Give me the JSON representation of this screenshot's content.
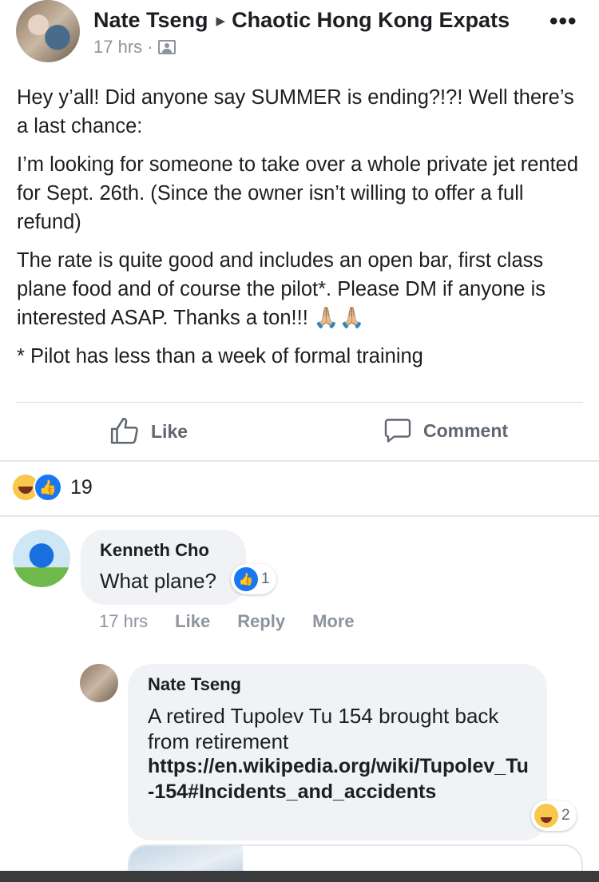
{
  "post": {
    "author": "Nate Tseng",
    "group": "Chaotic Hong Kong Expats",
    "time": "17 hrs ·",
    "paragraphs": [
      "Hey y’all! Did anyone say SUMMER is ending?!?! Well there’s a last chance:",
      "I’m looking for someone to take over a whole private jet rented for Sept. 26th. (Since the owner isn’t willing to offer a full refund)",
      "The rate is quite good and includes an open bar, first class plane food and of course the pilot*. Please DM if anyone is interested ASAP. Thanks a ton!!! 🙏🏼🙏🏼",
      "* Pilot has less than a week of formal training"
    ],
    "more_icon": "•••"
  },
  "actions": {
    "like_label": "Like",
    "comment_label": "Comment"
  },
  "reactions": {
    "count": "19",
    "icons": [
      "haha-icon",
      "like-icon"
    ]
  },
  "comments": [
    {
      "author": "Kenneth Cho",
      "text": "What plane?",
      "reaction_count": "1",
      "time": "17 hrs",
      "like": "Like",
      "reply": "Reply",
      "more": "More"
    }
  ],
  "reply": {
    "author": "Nate Tseng",
    "text": "A retired Tupolev Tu 154 brought back from retirement",
    "link": "https://en.wikipedia.org/wiki/Tupolev_Tu-154#Incidents_and_accidents",
    "reaction_count": "2"
  },
  "colors": {
    "accent": "#1877f2",
    "muted": "#8d949e",
    "bubble": "#f0f2f5"
  }
}
